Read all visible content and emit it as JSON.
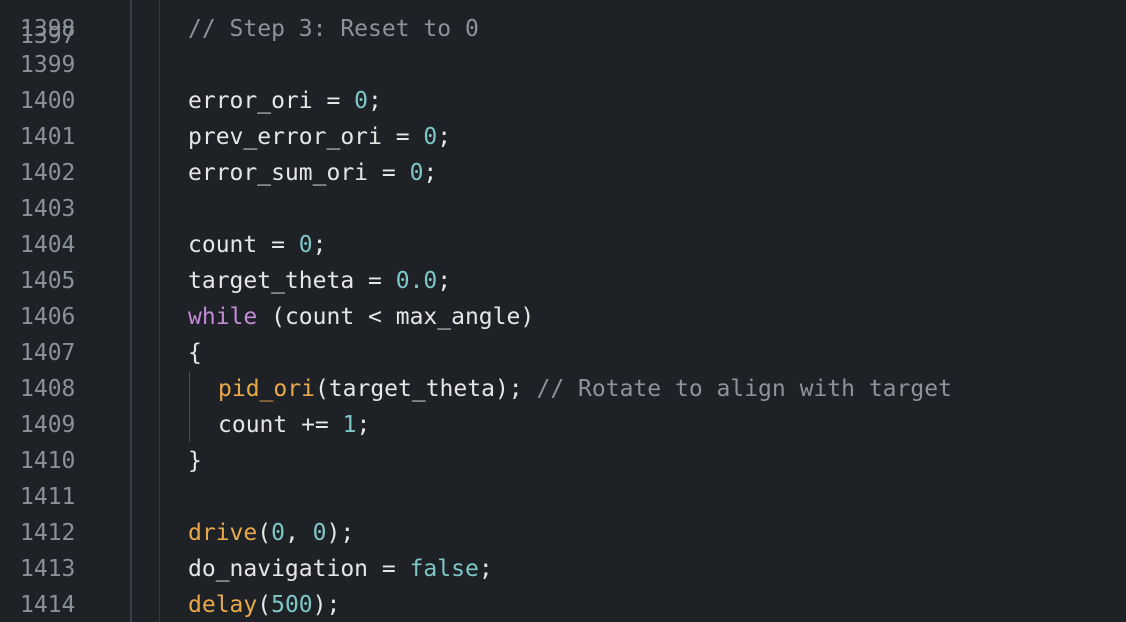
{
  "editor": {
    "partial_top_line_number": "1397",
    "lines": [
      {
        "number": "1398",
        "indent": 1,
        "tokens": [
          {
            "t": "// Step 3: Reset to 0",
            "c": "comment"
          }
        ]
      },
      {
        "number": "1399",
        "indent": 1,
        "tokens": []
      },
      {
        "number": "1400",
        "indent": 1,
        "tokens": [
          {
            "t": "error_ori = ",
            "c": "plain"
          },
          {
            "t": "0",
            "c": "number"
          },
          {
            "t": ";",
            "c": "plain"
          }
        ]
      },
      {
        "number": "1401",
        "indent": 1,
        "tokens": [
          {
            "t": "prev_error_ori = ",
            "c": "plain"
          },
          {
            "t": "0",
            "c": "number"
          },
          {
            "t": ";",
            "c": "plain"
          }
        ]
      },
      {
        "number": "1402",
        "indent": 1,
        "tokens": [
          {
            "t": "error_sum_ori = ",
            "c": "plain"
          },
          {
            "t": "0",
            "c": "number"
          },
          {
            "t": ";",
            "c": "plain"
          }
        ]
      },
      {
        "number": "1403",
        "indent": 1,
        "tokens": []
      },
      {
        "number": "1404",
        "indent": 1,
        "tokens": [
          {
            "t": "count = ",
            "c": "plain"
          },
          {
            "t": "0",
            "c": "number"
          },
          {
            "t": ";",
            "c": "plain"
          }
        ]
      },
      {
        "number": "1405",
        "indent": 1,
        "tokens": [
          {
            "t": "target_theta = ",
            "c": "plain"
          },
          {
            "t": "0.0",
            "c": "number"
          },
          {
            "t": ";",
            "c": "plain"
          }
        ]
      },
      {
        "number": "1406",
        "indent": 1,
        "tokens": [
          {
            "t": "while",
            "c": "keyword"
          },
          {
            "t": " (count < max_angle)",
            "c": "plain"
          }
        ]
      },
      {
        "number": "1407",
        "indent": 1,
        "tokens": [
          {
            "t": "{",
            "c": "plain"
          }
        ]
      },
      {
        "number": "1408",
        "indent": 2,
        "tokens": [
          {
            "t": "pid_ori",
            "c": "func"
          },
          {
            "t": "(target_theta); ",
            "c": "plain"
          },
          {
            "t": "// Rotate to align with target",
            "c": "comment"
          }
        ]
      },
      {
        "number": "1409",
        "indent": 2,
        "tokens": [
          {
            "t": "count += ",
            "c": "plain"
          },
          {
            "t": "1",
            "c": "number"
          },
          {
            "t": ";",
            "c": "plain"
          }
        ]
      },
      {
        "number": "1410",
        "indent": 1,
        "tokens": [
          {
            "t": "}",
            "c": "plain"
          }
        ]
      },
      {
        "number": "1411",
        "indent": 1,
        "tokens": []
      },
      {
        "number": "1412",
        "indent": 1,
        "tokens": [
          {
            "t": "drive",
            "c": "func"
          },
          {
            "t": "(",
            "c": "plain"
          },
          {
            "t": "0",
            "c": "number"
          },
          {
            "t": ", ",
            "c": "plain"
          },
          {
            "t": "0",
            "c": "number"
          },
          {
            "t": ");",
            "c": "plain"
          }
        ]
      },
      {
        "number": "1413",
        "indent": 1,
        "tokens": [
          {
            "t": "do_navigation = ",
            "c": "plain"
          },
          {
            "t": "false",
            "c": "bool"
          },
          {
            "t": ";",
            "c": "plain"
          }
        ]
      },
      {
        "number": "1414",
        "indent": 1,
        "tokens": [
          {
            "t": "delay",
            "c": "func"
          },
          {
            "t": "(",
            "c": "plain"
          },
          {
            "t": "500",
            "c": "number"
          },
          {
            "t": ");",
            "c": "plain"
          }
        ]
      }
    ]
  }
}
